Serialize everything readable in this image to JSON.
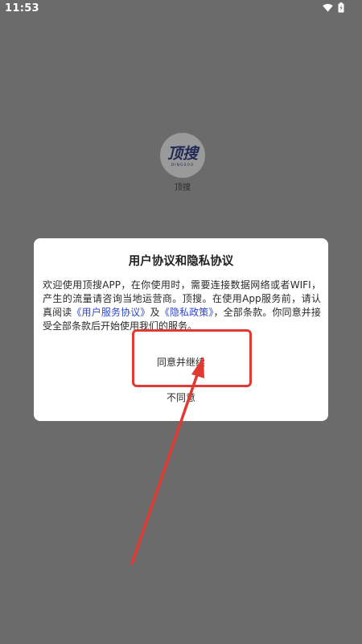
{
  "status_bar": {
    "time": "11:53",
    "icons": [
      "wifi-icon",
      "battery-icon"
    ]
  },
  "splash": {
    "logo_text": "顶搜",
    "logo_subtext": "DINGSOU",
    "app_name": "顶搜"
  },
  "dialog": {
    "title": "用户协议和隐私协议",
    "body": {
      "part1": "欢迎使用顶搜APP，在你使用时，需要连接数据网络或者WIFI，产生的流量请咨询当地运营商。顶搜。在使用App服务前，请认真阅读",
      "link_user_agreement": "《用户服务协议》",
      "part2": "及",
      "link_privacy_policy": "《隐私政策》",
      "part3": "，全部条款。你同意并接受全部条款后开始使用我们的服务。"
    },
    "agree_label": "同意并继续",
    "disagree_label": "不同意"
  },
  "colors": {
    "backdrop": "#6b6b6b",
    "link": "#2e47c6",
    "annotation": "#e03a33"
  }
}
